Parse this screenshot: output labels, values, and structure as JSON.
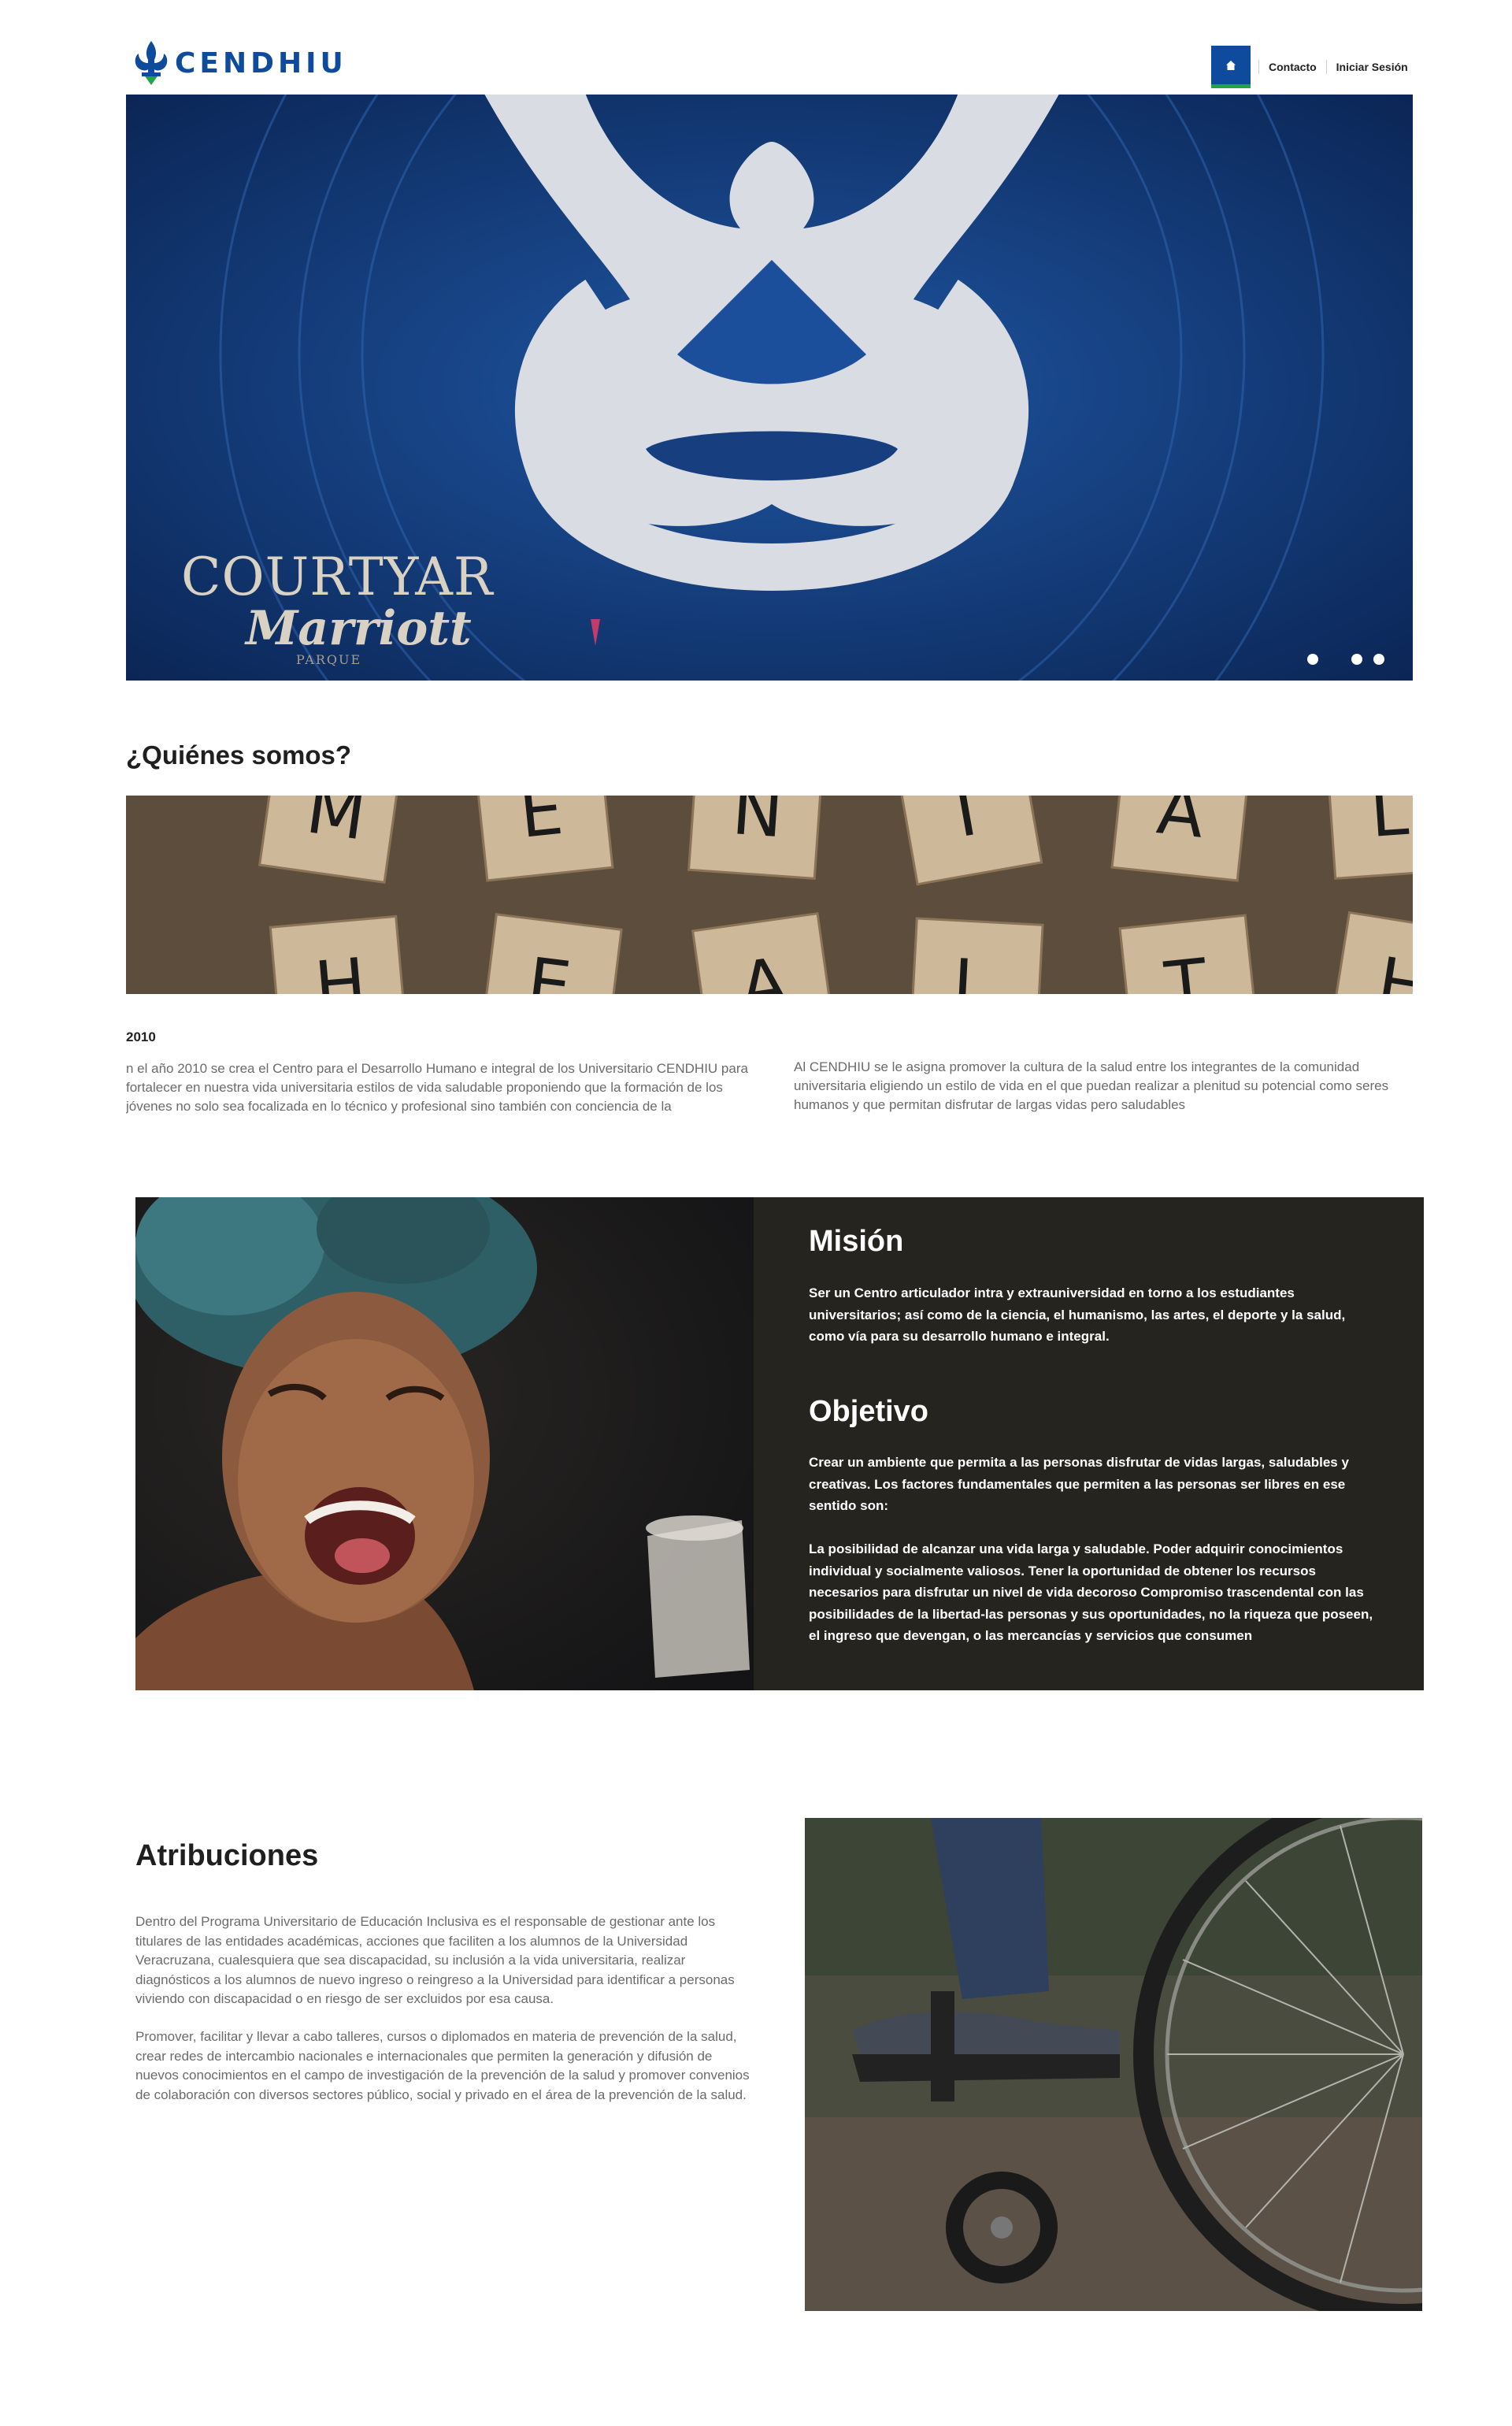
{
  "header": {
    "logo_text": "CENDHIU",
    "nav": {
      "home_icon": "home-icon",
      "contacto": "Contacto",
      "iniciar_sesion": "Iniciar Sesión"
    }
  },
  "hero": {
    "caption_line1": "COURTYAR",
    "caption_line2": "Marriott",
    "caption_line3": "PARQUE",
    "slide_count": 3
  },
  "quienes": {
    "title": "¿Quiénes somos?",
    "tiles_top": [
      "M",
      "E",
      "N",
      "T",
      "A",
      "L"
    ],
    "tiles_bottom": [
      "H",
      "E",
      "A",
      "L",
      "T",
      "H"
    ],
    "year": "2010",
    "paragraph_left": "n el año 2010 se crea el Centro para el Desarrollo Humano e integral de los Universitario CENDHIU para fortalecer en nuestra vida universitaria estilos de vida saludable proponiendo que la formación de los jóvenes no solo sea focalizada en lo técnico y profesional sino también con conciencia de la",
    "paragraph_right": "Al CENDHIU se le asigna promover la cultura de la salud entre los integrantes de la comunidad universitaria eligiendo un estilo de vida en el que puedan realizar a plenitud su potencial como seres humanos y que permitan disfrutar de largas vidas pero saludables"
  },
  "mision": {
    "title": "Misión",
    "text": "Ser un Centro articulador intra y extrauniversidad en torno a los estudiantes universitarios; así como de la ciencia, el humanismo, las artes,  el deporte y la salud, como vía para su  desarrollo humano e integral.",
    "objetivo_title": "Objetivo",
    "objetivo_text": "Crear un ambiente que permita a las personas disfrutar de vidas largas, saludables y creativas. Los factores fundamentales que permiten a las personas ser libres en ese sentido son:",
    "objetivo_list": "La posibilidad de alcanzar una vida larga y saludable. Poder adquirir conocimientos individual y socialmente valiosos. Tener la oportunidad de obtener los recursos necesarios para disfrutar un nivel de vida decoroso Compromiso trascendental con las posibilidades de la libertad-las personas y sus oportunidades, no la riqueza que poseen, el ingreso que devengan, o las mercancías y servicios que consumen"
  },
  "atribuciones": {
    "title": "Atribuciones",
    "paragraph1": "Dentro del Programa Universitario de Educación Inclusiva es el responsable de gestionar ante los titulares de las entidades académicas, acciones que faciliten a los alumnos de la Universidad Veracruzana, cualesquiera que sea discapacidad, su inclusión a la vida universitaria, realizar diagnósticos a los alumnos de nuevo ingreso o reingreso a la Universidad para identificar a personas viviendo con discapacidad o en riesgo de ser excluidos por esa causa.",
    "paragraph2": "Promover, facilitar y llevar a cabo talleres, cursos o diplomados en materia de prevención de la salud, crear redes de intercambio nacionales e internacionales que permiten la generación y difusión de nuevos conocimientos en el campo de investigación de la prevención de la salud y promover convenios de colaboración con diversos sectores público, social y privado en el área de la prevención de la salud."
  },
  "colors": {
    "brand_blue": "#0e4b9c",
    "brand_green": "#22a34a",
    "panel_dark": "#25241f",
    "body_text": "#6b6b6b"
  }
}
